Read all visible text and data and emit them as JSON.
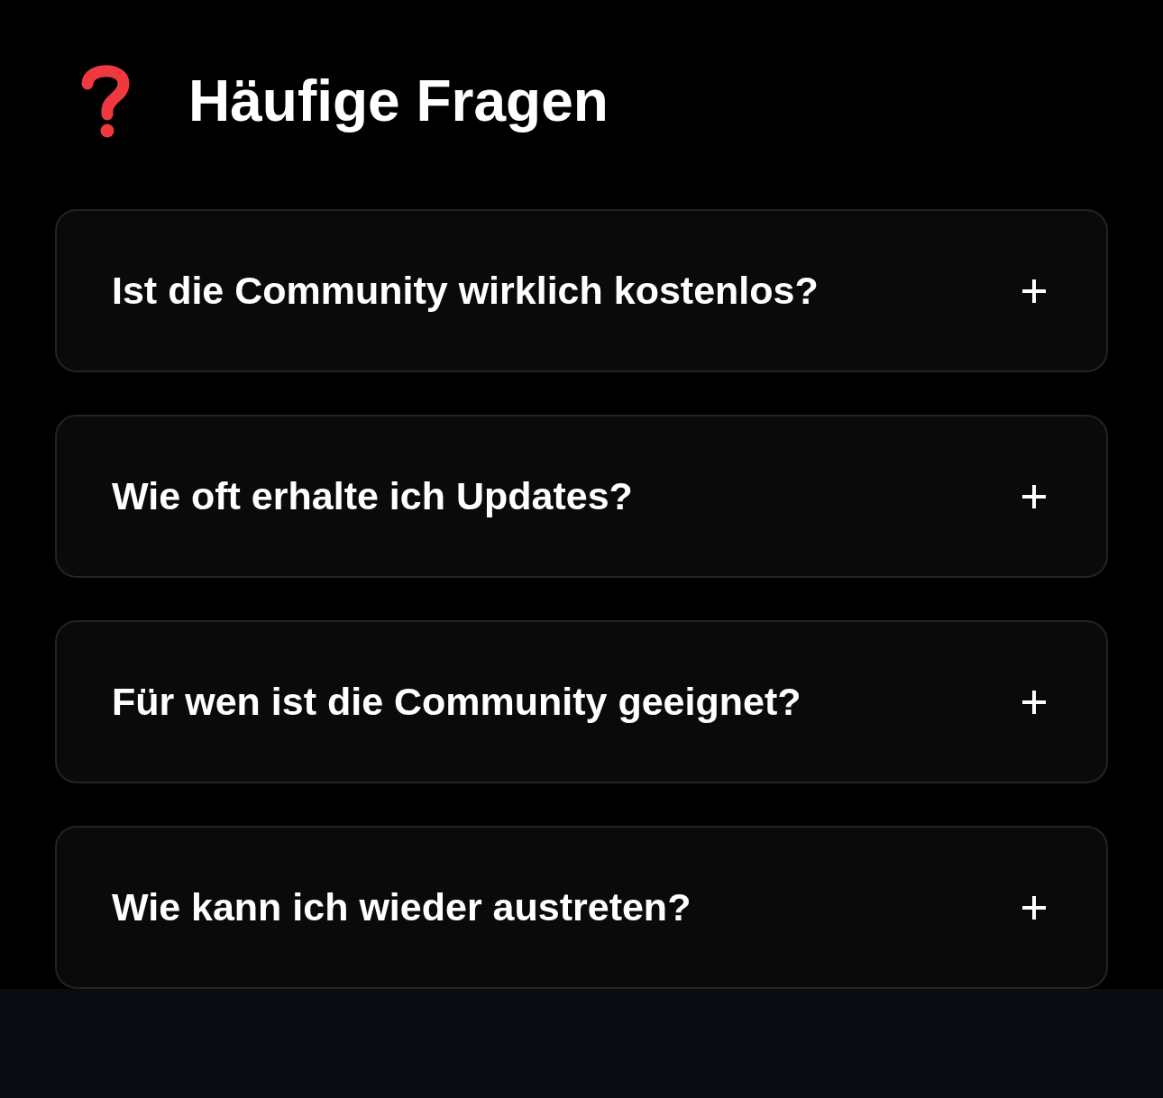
{
  "heading": {
    "title": "Häufige Fragen"
  },
  "faq": [
    {
      "question": "Ist die Community wirklich kostenlos?",
      "expanded": false
    },
    {
      "question": "Wie oft erhalte ich Updates?",
      "expanded": false
    },
    {
      "question": "Für wen ist die Community geeignet?",
      "expanded": false
    },
    {
      "question": "Wie kann ich wieder austreten?",
      "expanded": false
    }
  ]
}
